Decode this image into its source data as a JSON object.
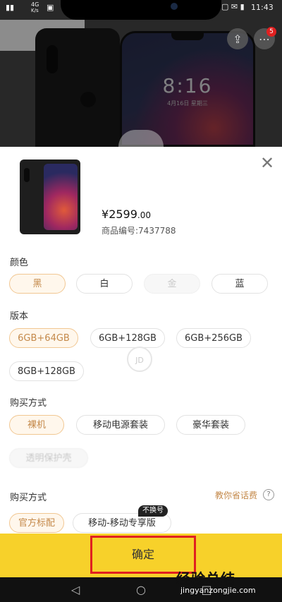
{
  "status": {
    "signal": "4G",
    "speed": "K/s",
    "time": "11:43"
  },
  "hero": {
    "clock": "8:16",
    "date": "4月16日 星期三",
    "cart_badge": "5"
  },
  "product": {
    "price_symbol": "¥",
    "price_main": "2599",
    "price_cents": ".00",
    "sku": "商品编号:7437788"
  },
  "color": {
    "label": "颜色",
    "options": [
      "黑",
      "白",
      "金",
      "蓝"
    ]
  },
  "version": {
    "label": "版本",
    "options": [
      "6GB+64GB",
      "6GB+128GB",
      "6GB+256GB",
      "8GB+128GB"
    ]
  },
  "purchase": {
    "label": "购买方式",
    "options": [
      "裸机",
      "移动电源套装",
      "豪华套装",
      "透明保护壳"
    ]
  },
  "purchase2": {
    "label": "购买方式",
    "tip": "教你省话费",
    "options": [
      "官方标配",
      "移动-移动专享版"
    ],
    "badge": "不换号"
  },
  "loading": {
    "text": "JD"
  },
  "confirm": {
    "label": "确定"
  },
  "nav": {
    "back": "◁",
    "home": "○",
    "recent": "□"
  },
  "watermark": {
    "text": "经验总结",
    "url": "jingyanzongjie.com"
  },
  "colors": {
    "accent": "#c4894a",
    "confirm_bg": "#f7d12a",
    "highlight": "#e02020"
  }
}
